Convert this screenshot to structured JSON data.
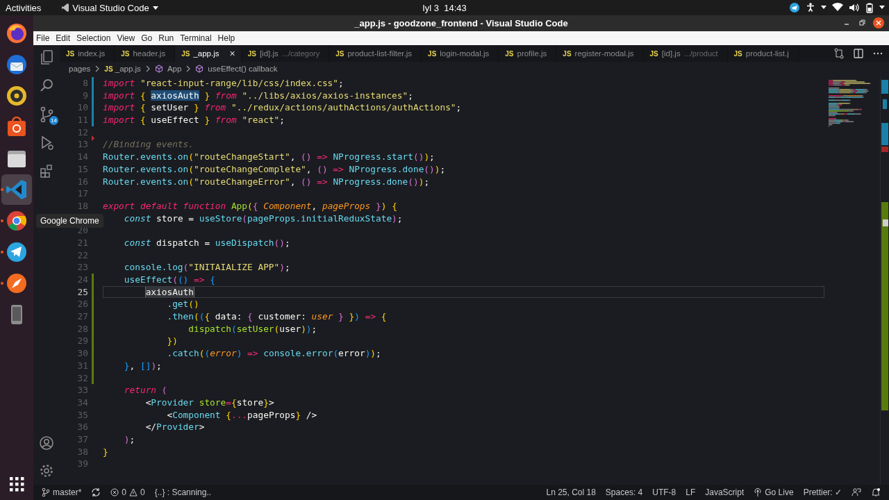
{
  "top_bar": {
    "activities": "Activities",
    "app_menu": "Visual Studio Code",
    "clock": "Iyl 3  14:43",
    "tray": [
      {
        "kind": "telegram"
      },
      {
        "kind": "accessibility"
      },
      {
        "kind": "caret"
      },
      {
        "kind": "wifi"
      },
      {
        "kind": "volume"
      },
      {
        "kind": "battery"
      },
      {
        "kind": "caret"
      }
    ]
  },
  "dock": {
    "items": [
      {
        "kind": "firefox",
        "running": false,
        "active": false
      },
      {
        "kind": "thunderbird",
        "running": false,
        "active": false
      },
      {
        "kind": "rhythmbox",
        "running": false,
        "active": false
      },
      {
        "kind": "software",
        "running": false,
        "active": false
      },
      {
        "kind": "files",
        "running": false,
        "active": false
      },
      {
        "kind": "vscode",
        "running": true,
        "active": true
      },
      {
        "kind": "chrome",
        "running": true,
        "active": false
      },
      {
        "kind": "telegram",
        "running": true,
        "active": false
      },
      {
        "kind": "compass",
        "running": true,
        "active": false
      },
      {
        "kind": "device",
        "running": false,
        "active": false
      }
    ],
    "tooltip": "Google Chrome"
  },
  "window": {
    "title": "_app.js - goodzone_frontend - Visual Studio Code"
  },
  "menu": [
    "File",
    "Edit",
    "Selection",
    "View",
    "Go",
    "Run",
    "Terminal",
    "Help"
  ],
  "activity_bar": {
    "items": [
      {
        "kind": "explorer"
      },
      {
        "kind": "search"
      },
      {
        "kind": "source-control",
        "badge": "14"
      },
      {
        "kind": "run"
      },
      {
        "kind": "extensions"
      }
    ],
    "bottom": [
      {
        "kind": "account"
      },
      {
        "kind": "settings"
      }
    ]
  },
  "tabs": [
    {
      "icon_text": "JS",
      "label": "index.js",
      "selected": false
    },
    {
      "icon_text": "JS",
      "label": "header.js",
      "selected": false
    },
    {
      "icon_text": "JS",
      "label": "_app.js",
      "selected": true,
      "close": "×"
    },
    {
      "icon_text": "JS",
      "label": "[id].js",
      "detail": ".../category",
      "selected": false
    },
    {
      "icon_text": "JS",
      "label": "product-list-filter.js",
      "selected": false
    },
    {
      "icon_text": "JS",
      "label": "login-modal.js",
      "selected": false
    },
    {
      "icon_text": "JS",
      "label": "profile.js",
      "selected": false
    },
    {
      "icon_text": "JS",
      "label": "register-modal.js",
      "selected": false
    },
    {
      "icon_text": "JS",
      "label": "[id].js",
      "detail": ".../product",
      "selected": false
    },
    {
      "icon_text": "JS",
      "label": "product-list.j",
      "selected": false
    }
  ],
  "editor": {
    "breadcrumb": [
      {
        "kind": "folder",
        "text": "pages"
      },
      {
        "kind": "file",
        "icon_text": "JS",
        "text": "_app.js"
      },
      {
        "kind": "symbol",
        "text": "App"
      },
      {
        "kind": "symbol",
        "text": "useEffect() callback"
      }
    ],
    "lines": [
      {
        "number": "8",
        "kind": "modified",
        "current": false,
        "tokens": [
          {
            "kind": "k",
            "text": "import "
          },
          {
            "kind": "s",
            "text": "\"react-input-range/lib/css/index.css\""
          },
          {
            "kind": "v",
            "text": ";"
          }
        ]
      },
      {
        "number": "9",
        "kind": "modified",
        "current": false,
        "tokens": [
          {
            "kind": "k",
            "text": "import "
          },
          {
            "kind": "b1",
            "text": "{ "
          },
          {
            "kind": "sel",
            "text": "axiosAuth"
          },
          {
            "kind": "b1",
            "text": " }"
          },
          {
            "kind": "k",
            "text": " from "
          },
          {
            "kind": "s",
            "text": "\"../libs/axios/axios-instances\""
          },
          {
            "kind": "v",
            "text": ";"
          }
        ]
      },
      {
        "number": "10",
        "kind": "modified",
        "current": false,
        "tokens": [
          {
            "kind": "k",
            "text": "import "
          },
          {
            "kind": "b1",
            "text": "{ "
          },
          {
            "kind": "v",
            "text": "setUser"
          },
          {
            "kind": "b1",
            "text": " }"
          },
          {
            "kind": "k",
            "text": " from "
          },
          {
            "kind": "s",
            "text": "\"../redux/actions/authActions/authActions\""
          },
          {
            "kind": "v",
            "text": ";"
          }
        ]
      },
      {
        "number": "11",
        "kind": "modified",
        "current": false,
        "tokens": [
          {
            "kind": "k",
            "text": "import "
          },
          {
            "kind": "b1",
            "text": "{ "
          },
          {
            "kind": "v",
            "text": "useEffect"
          },
          {
            "kind": "b1",
            "text": " }"
          },
          {
            "kind": "k",
            "text": " from "
          },
          {
            "kind": "s",
            "text": "\"react\""
          },
          {
            "kind": "v",
            "text": ";"
          }
        ]
      },
      {
        "number": "12",
        "kind": "plain",
        "current": false
      },
      {
        "number": "13",
        "kind": "deleted",
        "current": false,
        "tokens": [
          {
            "kind": "c",
            "text": "//Binding events."
          }
        ]
      },
      {
        "number": "14",
        "kind": "plain",
        "current": false,
        "tokens": [
          {
            "kind": "t",
            "text": "Router.events.on"
          },
          {
            "kind": "b1",
            "text": "("
          },
          {
            "kind": "s",
            "text": "\"routeChangeStart\""
          },
          {
            "kind": "v",
            "text": ", "
          },
          {
            "kind": "b2",
            "text": "()"
          },
          {
            "kind": "o",
            "text": " => "
          },
          {
            "kind": "t",
            "text": "NProgress.start"
          },
          {
            "kind": "b2",
            "text": "()"
          },
          {
            "kind": "b1",
            "text": ")"
          },
          {
            "kind": "v",
            "text": ";"
          }
        ]
      },
      {
        "number": "15",
        "kind": "plain",
        "current": false,
        "tokens": [
          {
            "kind": "t",
            "text": "Router.events.on"
          },
          {
            "kind": "b1",
            "text": "("
          },
          {
            "kind": "s",
            "text": "\"routeChangeComplete\""
          },
          {
            "kind": "v",
            "text": ", "
          },
          {
            "kind": "b2",
            "text": "()"
          },
          {
            "kind": "o",
            "text": " => "
          },
          {
            "kind": "t",
            "text": "NProgress.done"
          },
          {
            "kind": "b2",
            "text": "()"
          },
          {
            "kind": "b1",
            "text": ")"
          },
          {
            "kind": "v",
            "text": ";"
          }
        ]
      },
      {
        "number": "16",
        "kind": "plain",
        "current": false,
        "tokens": [
          {
            "kind": "t",
            "text": "Router.events.on"
          },
          {
            "kind": "b1",
            "text": "("
          },
          {
            "kind": "s",
            "text": "\"routeChangeError\""
          },
          {
            "kind": "v",
            "text": ", "
          },
          {
            "kind": "b2",
            "text": "()"
          },
          {
            "kind": "o",
            "text": " => "
          },
          {
            "kind": "t",
            "text": "NProgress.done"
          },
          {
            "kind": "b2",
            "text": "()"
          },
          {
            "kind": "b1",
            "text": ")"
          },
          {
            "kind": "v",
            "text": ";"
          }
        ]
      },
      {
        "number": "17",
        "kind": "plain",
        "current": false
      },
      {
        "number": "18",
        "kind": "plain",
        "current": false,
        "tokens": [
          {
            "kind": "k",
            "text": "export default function "
          },
          {
            "kind": "f",
            "text": "App"
          },
          {
            "kind": "b1",
            "text": "("
          },
          {
            "kind": "b2",
            "text": "{ "
          },
          {
            "kind": "p",
            "text": "Component"
          },
          {
            "kind": "v",
            "text": ", "
          },
          {
            "kind": "p",
            "text": "pageProps"
          },
          {
            "kind": "b2",
            "text": " }"
          },
          {
            "kind": "b1",
            "text": ") {"
          }
        ]
      },
      {
        "kind": "plain",
        "current": false,
        "tokens": [
          {
            "kind": "d",
            "text": "    const "
          },
          {
            "kind": "v",
            "text": "store = "
          },
          {
            "kind": "t",
            "text": "useStore"
          },
          {
            "kind": "b2",
            "text": "("
          },
          {
            "kind": "t",
            "text": "pageProps.initialReduxState"
          },
          {
            "kind": "b2",
            "text": ")"
          },
          {
            "kind": "v",
            "text": ";"
          }
        ]
      },
      {
        "number": "20",
        "kind": "plain",
        "current": false
      },
      {
        "number": "21",
        "kind": "plain",
        "current": false,
        "tokens": [
          {
            "kind": "d",
            "text": "    const "
          },
          {
            "kind": "v",
            "text": "dispatch = "
          },
          {
            "kind": "t",
            "text": "useDispatch"
          },
          {
            "kind": "b2",
            "text": "()"
          },
          {
            "kind": "v",
            "text": ";"
          }
        ]
      },
      {
        "number": "22",
        "kind": "plain",
        "current": false
      },
      {
        "number": "23",
        "kind": "plain",
        "current": false,
        "tokens": [
          {
            "kind": "t",
            "text": "    console.log"
          },
          {
            "kind": "b2",
            "text": "("
          },
          {
            "kind": "s",
            "text": "\"INITAIALIZE APP\""
          },
          {
            "kind": "b2",
            "text": ")"
          },
          {
            "kind": "v",
            "text": ";"
          }
        ]
      },
      {
        "number": "24",
        "kind": "added",
        "current": false,
        "tokens": [
          {
            "kind": "t",
            "text": "    useEffect"
          },
          {
            "kind": "b2",
            "text": "("
          },
          {
            "kind": "b3",
            "text": "()"
          },
          {
            "kind": "o",
            "text": " => "
          },
          {
            "kind": "b3",
            "text": "{"
          }
        ]
      },
      {
        "number": "25",
        "kind": "added",
        "current": true,
        "tokens": [
          {
            "kind": "hl",
            "text": "        axiosAuth"
          }
        ]
      },
      {
        "number": "26",
        "kind": "added",
        "current": false,
        "tokens": [
          {
            "kind": "t",
            "text": "            .get"
          },
          {
            "kind": "b1",
            "text": "()"
          }
        ]
      },
      {
        "number": "27",
        "kind": "added",
        "current": false,
        "tokens": [
          {
            "kind": "t",
            "text": "            .then"
          },
          {
            "kind": "b1",
            "text": "("
          },
          {
            "kind": "b3",
            "text": "("
          },
          {
            "kind": "b1",
            "text": "{ "
          },
          {
            "kind": "v",
            "text": "data: "
          },
          {
            "kind": "b2",
            "text": "{ "
          },
          {
            "kind": "v",
            "text": "customer: "
          },
          {
            "kind": "p",
            "text": "user"
          },
          {
            "kind": "b2",
            "text": " }"
          },
          {
            "kind": "b1",
            "text": " }"
          },
          {
            "kind": "b3",
            "text": ")"
          },
          {
            "kind": "o",
            "text": " => "
          },
          {
            "kind": "b1",
            "text": "{"
          }
        ]
      },
      {
        "number": "28",
        "kind": "added",
        "current": false,
        "tokens": [
          {
            "kind": "f",
            "text": "                dispatch"
          },
          {
            "kind": "b3",
            "text": "("
          },
          {
            "kind": "f",
            "text": "setUser"
          },
          {
            "kind": "b1",
            "text": "("
          },
          {
            "kind": "v",
            "text": "user"
          },
          {
            "kind": "b1",
            "text": ")"
          },
          {
            "kind": "b3",
            "text": ")"
          },
          {
            "kind": "v",
            "text": ";"
          }
        ]
      },
      {
        "number": "29",
        "kind": "added",
        "current": false,
        "tokens": [
          {
            "kind": "b1",
            "text": "            })"
          }
        ]
      },
      {
        "number": "30",
        "kind": "added",
        "current": false,
        "tokens": [
          {
            "kind": "t",
            "text": "            .catch"
          },
          {
            "kind": "b1",
            "text": "("
          },
          {
            "kind": "b3",
            "text": "("
          },
          {
            "kind": "p",
            "text": "error"
          },
          {
            "kind": "b3",
            "text": ")"
          },
          {
            "kind": "o",
            "text": " => "
          },
          {
            "kind": "t",
            "text": "console.error"
          },
          {
            "kind": "b3",
            "text": "("
          },
          {
            "kind": "v",
            "text": "error"
          },
          {
            "kind": "b3",
            "text": ")"
          },
          {
            "kind": "b1",
            "text": ")"
          },
          {
            "kind": "v",
            "text": ";"
          }
        ]
      },
      {
        "number": "31",
        "kind": "added",
        "current": false,
        "tokens": [
          {
            "kind": "b3",
            "text": "    }"
          },
          {
            "kind": "v",
            "text": ", "
          },
          {
            "kind": "b3",
            "text": "[]"
          },
          {
            "kind": "b2",
            "text": ")"
          },
          {
            "kind": "v",
            "text": ";"
          }
        ]
      },
      {
        "number": "32",
        "kind": "added",
        "current": false
      },
      {
        "number": "33",
        "kind": "plain",
        "current": false,
        "tokens": [
          {
            "kind": "k",
            "text": "    return "
          },
          {
            "kind": "b2",
            "text": "("
          }
        ]
      },
      {
        "number": "34",
        "kind": "plain",
        "current": false,
        "tokens": [
          {
            "kind": "v",
            "text": "        <"
          },
          {
            "kind": "t",
            "text": "Provider "
          },
          {
            "kind": "f",
            "text": "store"
          },
          {
            "kind": "o",
            "text": "="
          },
          {
            "kind": "b1",
            "text": "{"
          },
          {
            "kind": "v",
            "text": "store"
          },
          {
            "kind": "b1",
            "text": "}"
          },
          {
            "kind": "v",
            "text": ">"
          }
        ]
      },
      {
        "number": "35",
        "kind": "plain",
        "current": false,
        "tokens": [
          {
            "kind": "v",
            "text": "            <"
          },
          {
            "kind": "t",
            "text": "Component "
          },
          {
            "kind": "b1",
            "text": "{"
          },
          {
            "kind": "o",
            "text": "..."
          },
          {
            "kind": "v",
            "text": "pageProps"
          },
          {
            "kind": "b1",
            "text": "}"
          },
          {
            "kind": "v",
            "text": " />"
          }
        ]
      },
      {
        "number": "36",
        "kind": "plain",
        "current": false,
        "tokens": [
          {
            "kind": "v",
            "text": "        </"
          },
          {
            "kind": "t",
            "text": "Provider"
          },
          {
            "kind": "v",
            "text": ">"
          }
        ]
      },
      {
        "number": "37",
        "kind": "plain",
        "current": false,
        "tokens": [
          {
            "kind": "b2",
            "text": "    )"
          },
          {
            "kind": "v",
            "text": ";"
          }
        ]
      },
      {
        "number": "38",
        "kind": "plain",
        "current": false,
        "tokens": [
          {
            "kind": "b1",
            "text": "}"
          }
        ]
      },
      {
        "number": "39",
        "kind": "plain",
        "current": false
      }
    ]
  },
  "status_bar": {
    "left": [
      {
        "kind": "branch",
        "text": "master*"
      },
      {
        "kind": "sync"
      },
      {
        "kind": "problems",
        "errors": "0",
        "warnings": "0"
      },
      {
        "kind": "text",
        "text": "{..} : Scanning.."
      }
    ],
    "right": [
      {
        "kind": "text",
        "text": "Ln 25, Col 18"
      },
      {
        "kind": "text",
        "text": "Spaces: 4"
      },
      {
        "kind": "text",
        "text": "UTF-8"
      },
      {
        "kind": "text",
        "text": "LF"
      },
      {
        "kind": "text",
        "text": "JavaScript"
      },
      {
        "kind": "golive",
        "text": "Go Live"
      },
      {
        "kind": "text",
        "text": "Prettier: ✓"
      },
      {
        "kind": "feedback"
      },
      {
        "kind": "bell"
      }
    ]
  }
}
